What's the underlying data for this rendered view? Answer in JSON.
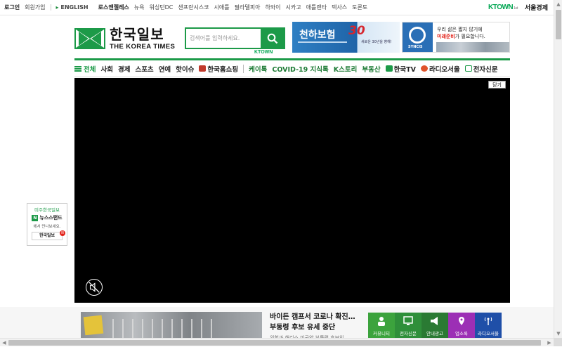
{
  "topbar": {
    "links": [
      "로그인",
      "회원가입"
    ],
    "english": "ENGLISH",
    "cities": [
      "로스앤젤레스",
      "뉴욕",
      "워싱턴DC",
      "샌프란시스코",
      "시애틀",
      "필라델피아",
      "하와이",
      "시카고",
      "애틀랜타",
      "텍사스",
      "토론토"
    ],
    "ktown": "KTOWN",
    "ktown_sub": "1st",
    "seoul": "서울경제"
  },
  "logo": {
    "ko": "한국일보",
    "en": "THE KOREA TIMES"
  },
  "search": {
    "placeholder": "검색어를 입력하세요."
  },
  "ktown_badge": "KTOWN",
  "ads": {
    "ad1": {
      "title": "천하보험",
      "num": "30",
      "sub": "새로운 30년을 향해!"
    },
    "ad2": {
      "brand": "SYNCIS",
      "line1": "우리 삶은 짧지 않기에",
      "line2_pre": "미래준비",
      "line2_post": "가 필요합니다."
    }
  },
  "nav": {
    "all": "전체",
    "items": [
      "사회",
      "경제",
      "스포츠",
      "연예",
      "핫이슈"
    ],
    "shopping": "한국홈쇼핑",
    "items2": [
      "케이톡",
      "COVID-19 지식톡",
      "K스토리",
      "부동산"
    ],
    "tv": "한국TV",
    "radio": "라디오서울",
    "paper": "전자신문"
  },
  "video": {
    "close": "닫기"
  },
  "sidebar": {
    "line1": "미주한국일보",
    "line2": "뉴스스탠드",
    "n": "N",
    "line3": "에서 만나보세요.",
    "logo": "한국일보"
  },
  "bottom": {
    "headline": "바이든 캠프서 코로나 확진…부동령 후보 유세 중단",
    "sub": "위험과 해리스 미국양 부통령 후보의"
  },
  "tiles": [
    "커뮤니티",
    "전자신문",
    "안내광고",
    "업소록",
    "라디오서울"
  ],
  "colors": {
    "brand_green": "#1c9a48",
    "accent_red": "#e2231a"
  }
}
